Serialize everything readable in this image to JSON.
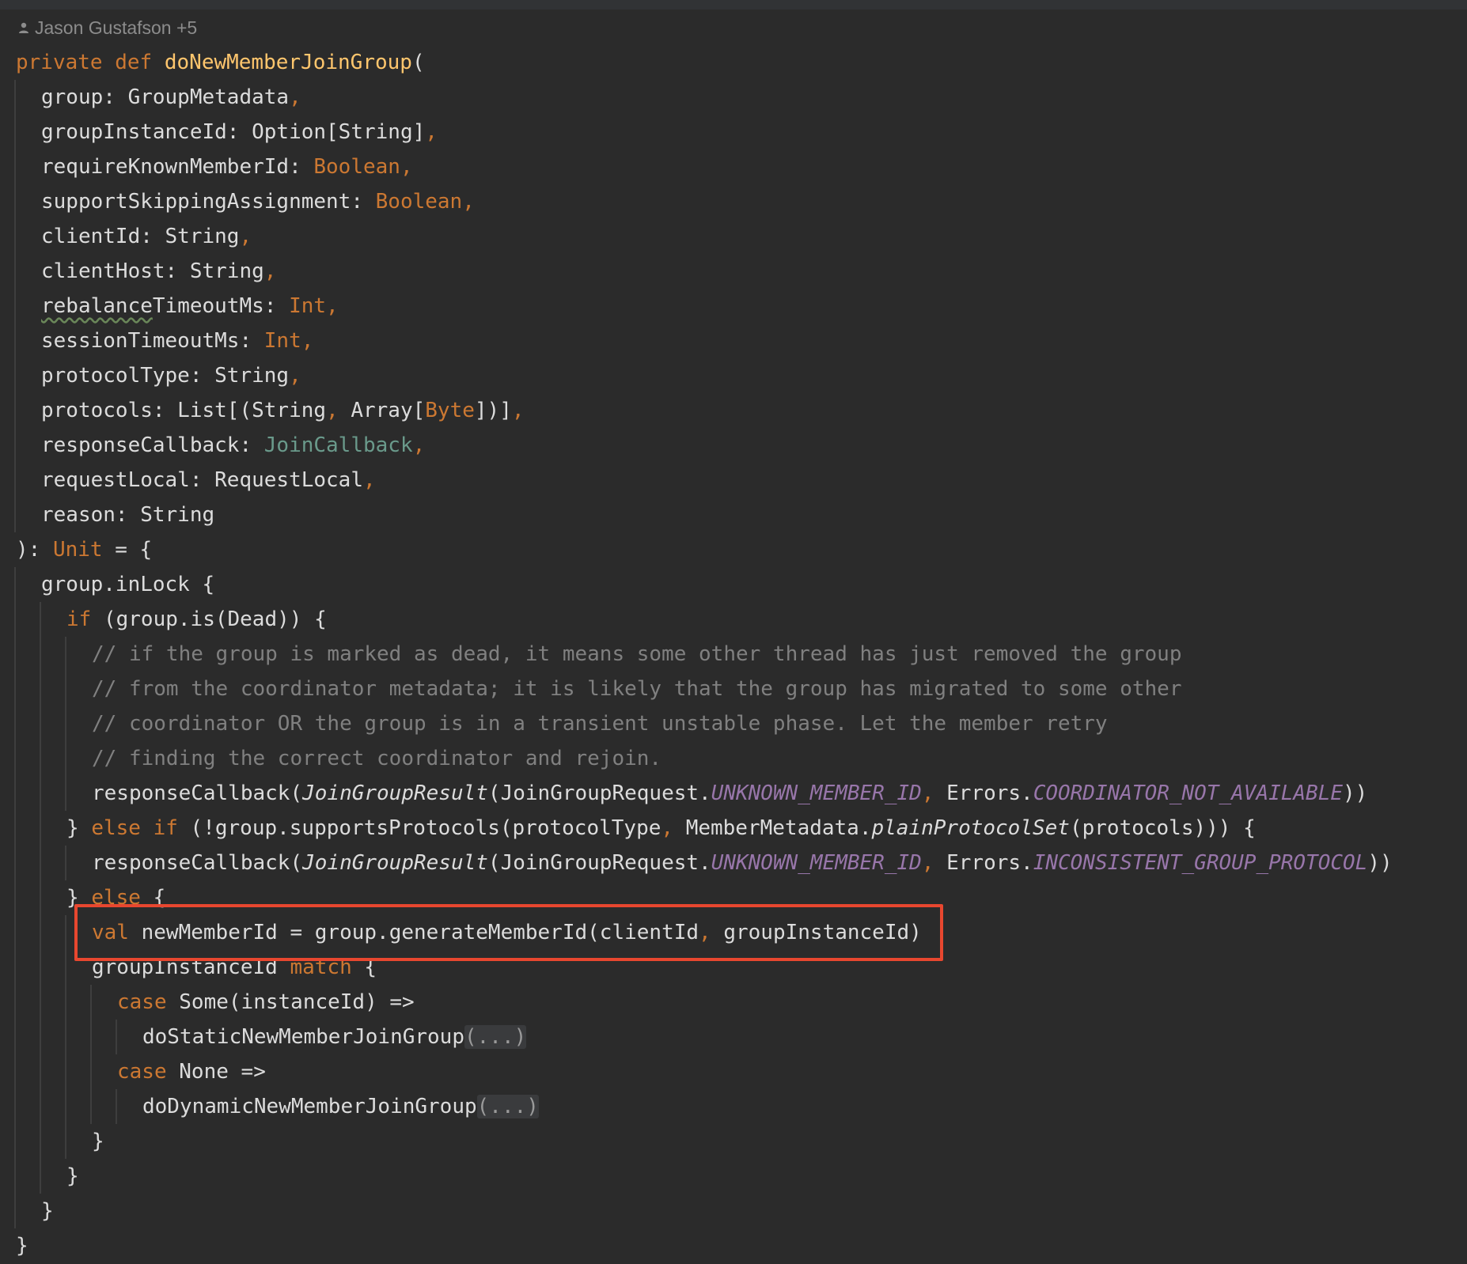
{
  "author": {
    "name": "Jason Gustafson +5",
    "icon": "person-icon"
  },
  "highlight": {
    "line_index": 25,
    "color": "#e8472f"
  },
  "code_lines": [
    {
      "indent": 0,
      "tokens": [
        {
          "t": "private ",
          "c": "kw"
        },
        {
          "t": "def ",
          "c": "kw"
        },
        {
          "t": "doNewMemberJoinGroup",
          "c": "fn"
        },
        {
          "t": "(",
          "c": "plain"
        }
      ]
    },
    {
      "indent": 1,
      "tokens": [
        {
          "t": "group: GroupMetadata",
          "c": "plain"
        },
        {
          "t": ",",
          "c": "punct"
        }
      ]
    },
    {
      "indent": 1,
      "tokens": [
        {
          "t": "groupInstanceId: Option[String]",
          "c": "plain"
        },
        {
          "t": ",",
          "c": "punct"
        }
      ]
    },
    {
      "indent": 1,
      "tokens": [
        {
          "t": "requireKnownMemberId: ",
          "c": "plain"
        },
        {
          "t": "Boolean",
          "c": "type"
        },
        {
          "t": ",",
          "c": "punct"
        }
      ]
    },
    {
      "indent": 1,
      "tokens": [
        {
          "t": "supportSkippingAssignment: ",
          "c": "plain"
        },
        {
          "t": "Boolean",
          "c": "type"
        },
        {
          "t": ",",
          "c": "punct"
        }
      ]
    },
    {
      "indent": 1,
      "tokens": [
        {
          "t": "clientId: String",
          "c": "plain"
        },
        {
          "t": ",",
          "c": "punct"
        }
      ]
    },
    {
      "indent": 1,
      "tokens": [
        {
          "t": "clientHost: String",
          "c": "plain"
        },
        {
          "t": ",",
          "c": "punct"
        }
      ]
    },
    {
      "indent": 1,
      "tokens": [
        {
          "t": "rebalance",
          "c": "squig"
        },
        {
          "t": "TimeoutMs: ",
          "c": "plain"
        },
        {
          "t": "Int",
          "c": "type"
        },
        {
          "t": ",",
          "c": "punct"
        }
      ]
    },
    {
      "indent": 1,
      "tokens": [
        {
          "t": "sessionTimeoutMs: ",
          "c": "plain"
        },
        {
          "t": "Int",
          "c": "type"
        },
        {
          "t": ",",
          "c": "punct"
        }
      ]
    },
    {
      "indent": 1,
      "tokens": [
        {
          "t": "protocolType: String",
          "c": "plain"
        },
        {
          "t": ",",
          "c": "punct"
        }
      ]
    },
    {
      "indent": 1,
      "tokens": [
        {
          "t": "protocols: List[(String",
          "c": "plain"
        },
        {
          "t": ", ",
          "c": "punct"
        },
        {
          "t": "Array[",
          "c": "plain"
        },
        {
          "t": "Byte",
          "c": "type"
        },
        {
          "t": "])]",
          "c": "plain"
        },
        {
          "t": ",",
          "c": "punct"
        }
      ]
    },
    {
      "indent": 1,
      "tokens": [
        {
          "t": "responseCallback: ",
          "c": "plain"
        },
        {
          "t": "JoinCallback",
          "c": "alias"
        },
        {
          "t": ",",
          "c": "punct"
        }
      ]
    },
    {
      "indent": 1,
      "tokens": [
        {
          "t": "requestLocal: RequestLocal",
          "c": "plain"
        },
        {
          "t": ",",
          "c": "punct"
        }
      ]
    },
    {
      "indent": 1,
      "tokens": [
        {
          "t": "reason: String",
          "c": "plain"
        }
      ]
    },
    {
      "indent": 0,
      "tokens": [
        {
          "t": "): ",
          "c": "plain"
        },
        {
          "t": "Unit",
          "c": "type"
        },
        {
          "t": " = {",
          "c": "plain"
        }
      ]
    },
    {
      "indent": 1,
      "tokens": [
        {
          "t": "group.inLock {",
          "c": "plain"
        }
      ]
    },
    {
      "indent": 2,
      "tokens": [
        {
          "t": "if ",
          "c": "kw"
        },
        {
          "t": "(group.is(Dead)) {",
          "c": "plain"
        }
      ]
    },
    {
      "indent": 3,
      "tokens": [
        {
          "t": "// if the group is marked as dead, it means some other thread has just removed the group",
          "c": "comment"
        }
      ]
    },
    {
      "indent": 3,
      "tokens": [
        {
          "t": "// from the coordinator metadata; it is likely that the group has migrated to some other",
          "c": "comment"
        }
      ]
    },
    {
      "indent": 3,
      "tokens": [
        {
          "t": "// coordinator OR the group is in a transient unstable phase. Let the member retry",
          "c": "comment"
        }
      ]
    },
    {
      "indent": 3,
      "tokens": [
        {
          "t": "// finding the correct coordinator and rejoin.",
          "c": "comment"
        }
      ]
    },
    {
      "indent": 3,
      "tokens": [
        {
          "t": "responseCallback(",
          "c": "plain"
        },
        {
          "t": "JoinGroupResult",
          "c": "italic"
        },
        {
          "t": "(JoinGroupRequest.",
          "c": "plain"
        },
        {
          "t": "UNKNOWN_MEMBER_ID",
          "c": "const"
        },
        {
          "t": ", ",
          "c": "punct"
        },
        {
          "t": "Errors.",
          "c": "plain"
        },
        {
          "t": "COORDINATOR_NOT_AVAILABLE",
          "c": "const"
        },
        {
          "t": "))",
          "c": "plain"
        }
      ]
    },
    {
      "indent": 2,
      "tokens": [
        {
          "t": "} ",
          "c": "plain"
        },
        {
          "t": "else if ",
          "c": "kw"
        },
        {
          "t": "(!group.supportsProtocols(protocolType",
          "c": "plain"
        },
        {
          "t": ", ",
          "c": "punct"
        },
        {
          "t": "MemberMetadata.",
          "c": "plain"
        },
        {
          "t": "plainProtocolSet",
          "c": "italic"
        },
        {
          "t": "(protocols))) {",
          "c": "plain"
        }
      ]
    },
    {
      "indent": 3,
      "tokens": [
        {
          "t": "responseCallback(",
          "c": "plain"
        },
        {
          "t": "JoinGroupResult",
          "c": "italic"
        },
        {
          "t": "(JoinGroupRequest.",
          "c": "plain"
        },
        {
          "t": "UNKNOWN_MEMBER_ID",
          "c": "const"
        },
        {
          "t": ", ",
          "c": "punct"
        },
        {
          "t": "Errors.",
          "c": "plain"
        },
        {
          "t": "INCONSISTENT_GROUP_PROTOCOL",
          "c": "const"
        },
        {
          "t": "))",
          "c": "plain"
        }
      ]
    },
    {
      "indent": 2,
      "tokens": [
        {
          "t": "} ",
          "c": "plain"
        },
        {
          "t": "else ",
          "c": "kw"
        },
        {
          "t": "{",
          "c": "plain"
        }
      ]
    },
    {
      "indent": 3,
      "tokens": [
        {
          "t": "val ",
          "c": "kw"
        },
        {
          "t": "newMemberId = group.generateMemberId(clientId",
          "c": "plain"
        },
        {
          "t": ", ",
          "c": "punct"
        },
        {
          "t": "groupInstanceId)",
          "c": "plain"
        }
      ]
    },
    {
      "indent": 3,
      "tokens": [
        {
          "t": "groupInstanceId ",
          "c": "plain"
        },
        {
          "t": "match ",
          "c": "kw"
        },
        {
          "t": "{",
          "c": "plain"
        }
      ]
    },
    {
      "indent": 4,
      "tokens": [
        {
          "t": "case ",
          "c": "kw"
        },
        {
          "t": "Some(instanceId) =>",
          "c": "plain"
        }
      ]
    },
    {
      "indent": 5,
      "tokens": [
        {
          "t": "doStaticNewMemberJoinGroup",
          "c": "plain"
        },
        {
          "t": "(...)",
          "c": "fold"
        }
      ]
    },
    {
      "indent": 4,
      "tokens": [
        {
          "t": "case ",
          "c": "kw"
        },
        {
          "t": "None =>",
          "c": "plain"
        }
      ]
    },
    {
      "indent": 5,
      "tokens": [
        {
          "t": "doDynamicNewMemberJoinGroup",
          "c": "plain"
        },
        {
          "t": "(...)",
          "c": "fold"
        }
      ]
    },
    {
      "indent": 3,
      "tokens": [
        {
          "t": "}",
          "c": "plain"
        }
      ]
    },
    {
      "indent": 2,
      "tokens": [
        {
          "t": "}",
          "c": "plain"
        }
      ]
    },
    {
      "indent": 1,
      "tokens": [
        {
          "t": "}",
          "c": "plain"
        }
      ]
    },
    {
      "indent": 0,
      "tokens": [
        {
          "t": "}",
          "c": "plain"
        }
      ]
    }
  ]
}
